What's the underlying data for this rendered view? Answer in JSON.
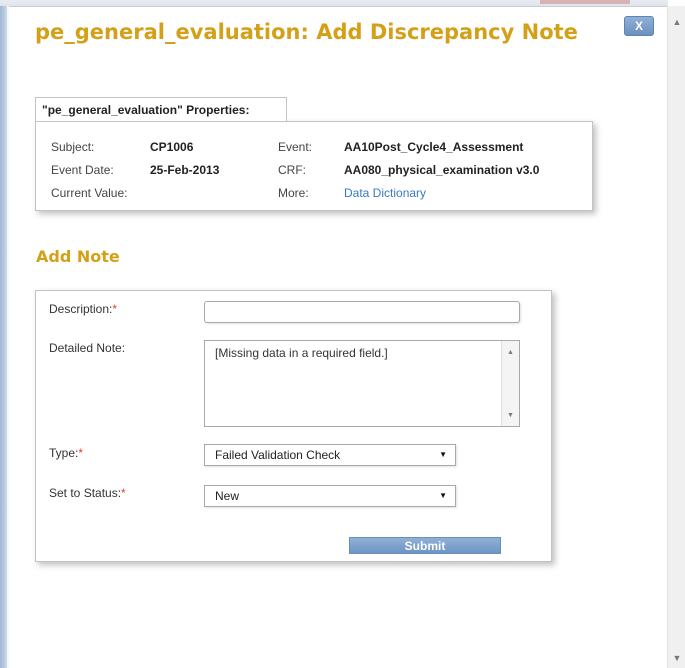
{
  "dialog": {
    "title": "pe_general_evaluation: Add Discrepancy Note",
    "close_label": "X"
  },
  "properties": {
    "header": "\"pe_general_evaluation\" Properties:",
    "subject_label": "Subject:",
    "subject_value": "CP1006",
    "event_date_label": "Event Date:",
    "event_date_value": "25-Feb-2013",
    "current_value_label": "Current Value:",
    "event_label": "Event:",
    "event_value": "AA10Post_Cycle4_Assessment",
    "crf_label": "CRF:",
    "crf_value": "AA080_physical_examination v3.0",
    "more_label": "More:",
    "more_link": "Data Dictionary"
  },
  "add_note": {
    "heading": "Add Note",
    "required_marker": "*",
    "description_label": "Description:",
    "description_value": "",
    "detailed_note_label": "Detailed Note:",
    "detailed_note_value": "[Missing data in a required field.]",
    "type_label": "Type:",
    "type_value": "Failed Validation Check",
    "status_label": "Set to Status:",
    "status_value": "New",
    "submit_label": "Submit"
  },
  "colors": {
    "accent": "#d4a017",
    "link": "#3a78c2",
    "button": "#7ea3cd",
    "required": "#e0441c"
  }
}
